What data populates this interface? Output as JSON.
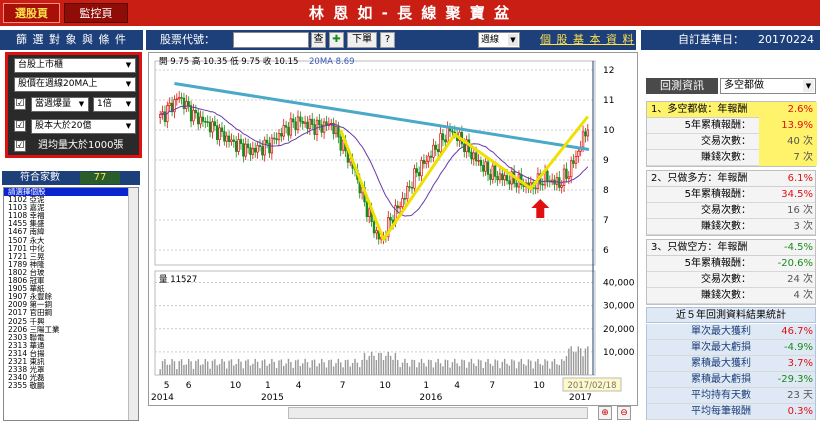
{
  "header": {
    "tabs": [
      {
        "label": "選股頁",
        "active": true
      },
      {
        "label": "監控頁",
        "active": false
      }
    ],
    "title": "林 恩 如 - 長 線 聚 寶 盆"
  },
  "toolbar": {
    "filter_title": "篩 選 對 象 與 條 件",
    "stock_code_label": "股票代號：",
    "stock_code_value": "",
    "query_btn": "查",
    "add_btn": "✚",
    "download_btn": "下單",
    "help_btn": "?",
    "period_value": "週線",
    "basic_info_link": "個 股 基 本 資 料",
    "base_date_label": "自訂基準日：",
    "base_date_value": "20170224"
  },
  "filters": {
    "market": "台股上市櫃",
    "ma_condition": "股價在週線20MA上",
    "volume_label": "當週爆量",
    "volume_multiplier": "1倍",
    "capital_label": "股本大於20億",
    "weekly_volume_label": "週均量大於1000張"
  },
  "results": {
    "count_label": "符合家數",
    "count_value": "77",
    "items": [
      "請選擇個股",
      "1102 亞泥",
      "1103 嘉泥",
      "1108 幸福",
      "1455 集盛",
      "1467 南緯",
      "1507 永大",
      "1701 中化",
      "1721 三晃",
      "1789 神隆",
      "1802 台玻",
      "1806 冠軍",
      "1905 華紙",
      "1907 永豐餘",
      "2009 第一銅",
      "2017 官田鋼",
      "2025 千興",
      "2206 三陽工業",
      "2303 聯電",
      "2313 華通",
      "2314 台揚",
      "2321 東訊",
      "2338 光罩",
      "2340 光磊",
      "2355 敬鵬"
    ]
  },
  "chart": {
    "price_readout": "開 9.75  高 10.35  低 9.75  收 10.15",
    "ma_readout": "20MA 8.69",
    "volume_readout": "量 11527",
    "price_ticks": [
      "12",
      "11",
      "10",
      "9",
      "8",
      "7",
      "6"
    ],
    "volume_ticks": [
      "40,000",
      "30,000",
      "20,000",
      "10,000"
    ],
    "x_ticks": [
      "5",
      "6",
      "10",
      "1",
      "4",
      "7",
      "10",
      "1",
      "4",
      "7",
      "10",
      "1"
    ],
    "x_years": [
      "2014",
      "2015",
      "2016",
      "2017"
    ],
    "cursor_date": "2017/02/18",
    "colors": {
      "up": "#e01010",
      "down": "#1a8a1a",
      "ma": "#6a3aa8",
      "trend": "#4aa8c8",
      "pattern": "#f0e000",
      "signal": "#e01010"
    }
  },
  "chart_data": {
    "type": "candlestick",
    "ylim": [
      5.5,
      12.3
    ],
    "price_ticks": [
      12,
      11,
      10,
      9,
      8,
      7,
      6
    ],
    "volume_ticks": [
      40000,
      30000,
      20000,
      10000
    ],
    "last_bar": {
      "open": 9.75,
      "high": 10.35,
      "low": 9.75,
      "close": 10.15,
      "volume": 11527
    },
    "ma20_last": 8.69
  },
  "backtest": {
    "title": "回測資訊",
    "mode_value": "多空都做",
    "section1": {
      "head": "1、多空都做：年報酬",
      "annual": "2.6%",
      "rows": [
        {
          "label": "5年累積報酬：",
          "value": "13.9%"
        },
        {
          "label": "交易次數：",
          "value": "40 次"
        },
        {
          "label": "賺錢次數：",
          "value": "7 次"
        }
      ]
    },
    "section2": {
      "head": "2、只做多方：年報酬",
      "annual": "6.1%",
      "rows": [
        {
          "label": "5年累積報酬：",
          "value": "34.5%"
        },
        {
          "label": "交易次數：",
          "value": "16 次"
        },
        {
          "label": "賺錢次數：",
          "value": "3 次"
        }
      ]
    },
    "section3": {
      "head": "3、只做空方：年報酬",
      "annual": "-4.5%",
      "rows": [
        {
          "label": "5年累積報酬：",
          "value": "-20.6%"
        },
        {
          "label": "交易次數：",
          "value": "24 次"
        },
        {
          "label": "賺錢次數：",
          "value": "4 次"
        }
      ]
    },
    "stats": {
      "head": "近５年回測資料結果統計",
      "rows": [
        {
          "label": "單次最大獲利",
          "value": "46.7%"
        },
        {
          "label": "單次最大虧損",
          "value": "-4.9%"
        },
        {
          "label": "累積最大獲利",
          "value": "3.7%"
        },
        {
          "label": "累積最大虧損",
          "value": "-29.3%"
        },
        {
          "label": "平均持有天數",
          "value": "23 天"
        },
        {
          "label": "平均每筆報酬",
          "value": "0.3%"
        }
      ]
    }
  }
}
